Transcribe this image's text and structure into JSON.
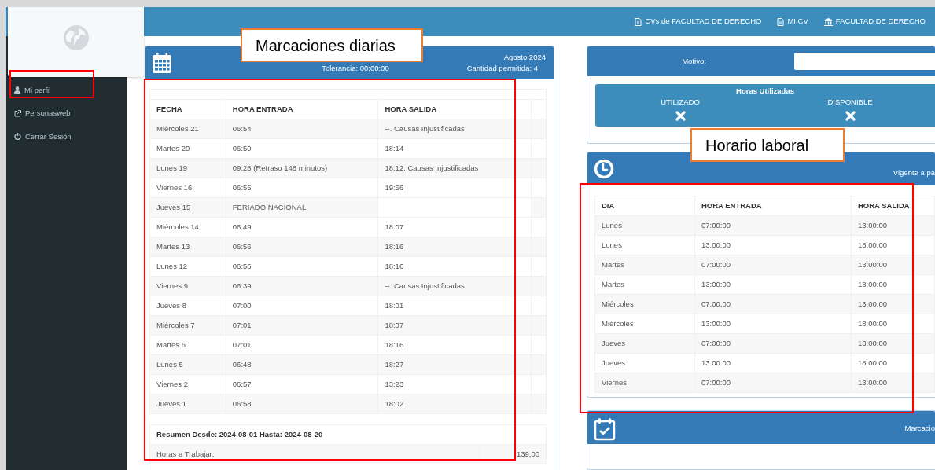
{
  "nav_links": [
    {
      "kind": "document",
      "label": "CVs de FACULTAD DE DERECHO"
    },
    {
      "kind": "document",
      "label": "MI CV"
    },
    {
      "kind": "building",
      "label": "FACULTAD DE DERECHO"
    }
  ],
  "sidebar": {
    "items": [
      {
        "kind": "user",
        "label": "Mi perfil"
      },
      {
        "kind": "external",
        "label": "Personasweb"
      },
      {
        "kind": "power",
        "label": "Cerrar Sesión"
      }
    ]
  },
  "marcaciones": {
    "month": "Agosto 2024",
    "tolerance": "Tolerancia: 00:00:00",
    "allowed": "Cantidad permitida: 4",
    "columns": [
      "FECHA",
      "HORA ENTRADA",
      "HORA SALIDA"
    ],
    "rows": [
      [
        "Miércoles 21",
        "06:54",
        "--. Causas Injustificadas"
      ],
      [
        "Martes 20",
        "06:59",
        "18:14"
      ],
      [
        "Lunes 19",
        "09:28 (Retraso 148 minutos)",
        "18:12. Causas Injustificadas"
      ],
      [
        "Viernes 16",
        "06:55",
        "19:56"
      ],
      [
        "Jueves 15",
        "FERIADO NACIONAL"
      ],
      [
        "Miércoles 14",
        "06:49",
        "18:07"
      ],
      [
        "Martes 13",
        "06:56",
        "18:16"
      ],
      [
        "Lunes 12",
        "06:56",
        "18:16"
      ],
      [
        "Viernes 9",
        "06:39",
        "--. Causas Injustificadas"
      ],
      [
        "Jueves 8",
        "07:00",
        "18:01"
      ],
      [
        "Miércoles 7",
        "07:01",
        "18:07"
      ],
      [
        "Martes 6",
        "07:01",
        "18:16"
      ],
      [
        "Lunes 5",
        "06:48",
        "18:27"
      ],
      [
        "Viernes 2",
        "06:57",
        "13:23"
      ],
      [
        "Jueves 1",
        "06:58",
        "18:02"
      ]
    ],
    "summary": {
      "title": "Resumen Desde: 2024-08-01 Hasta: 2024-08-20",
      "rows": [
        [
          "Horas a Trabajar:",
          "139,00"
        ]
      ]
    }
  },
  "motivo": {
    "label": "Motivo:"
  },
  "horas_utilizadas": {
    "title": "Horas Utilizadas",
    "columns": [
      "UTILIZADO",
      "DISPONIBLE"
    ]
  },
  "horario": {
    "note": "Vigente a pa",
    "columns": [
      "DIA",
      "HORA ENTRADA",
      "HORA SALIDA"
    ],
    "rows": [
      [
        "Lunes",
        "07:00:00",
        "13:00:00"
      ],
      [
        "Lunes",
        "13:00:00",
        "18:00:00"
      ],
      [
        "Martes",
        "07:00:00",
        "13:00:00"
      ],
      [
        "Martes",
        "13:00:00",
        "18:00:00"
      ],
      [
        "Miércoles",
        "07:00:00",
        "13:00:00"
      ],
      [
        "Miércoles",
        "13:00:00",
        "18:00:00"
      ],
      [
        "Jueves",
        "07:00:00",
        "13:00:00"
      ],
      [
        "Jueves",
        "13:00:00",
        "18:00:00"
      ],
      [
        "Viernes",
        "07:00:00",
        "13:00:00"
      ]
    ]
  },
  "marcaciones_panel": {
    "title": "Marcacio"
  },
  "annotations": [
    {
      "text": "Marcaciones diarias"
    },
    {
      "text": "Horario laboral"
    }
  ]
}
